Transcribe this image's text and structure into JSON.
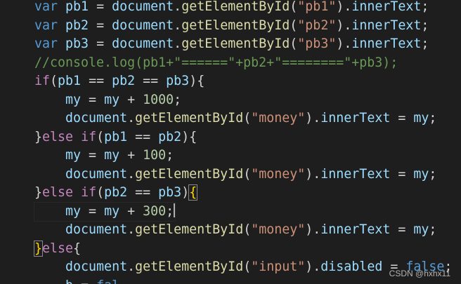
{
  "editor": {
    "lines": [
      [
        {
          "t": "var",
          "c": "kw"
        },
        {
          "t": " "
        },
        {
          "t": "pb1",
          "c": "var"
        },
        {
          "t": " = "
        },
        {
          "t": "document",
          "c": "var"
        },
        {
          "t": "."
        },
        {
          "t": "getElementById",
          "c": "fn"
        },
        {
          "t": "("
        },
        {
          "t": "\"pb1\"",
          "c": "str"
        },
        {
          "t": ")."
        },
        {
          "t": "innerText",
          "c": "var"
        },
        {
          "t": ";"
        }
      ],
      [
        {
          "t": "var",
          "c": "kw"
        },
        {
          "t": " "
        },
        {
          "t": "pb2",
          "c": "var"
        },
        {
          "t": " = "
        },
        {
          "t": "document",
          "c": "var"
        },
        {
          "t": "."
        },
        {
          "t": "getElementById",
          "c": "fn"
        },
        {
          "t": "("
        },
        {
          "t": "\"pb2\"",
          "c": "str"
        },
        {
          "t": ")."
        },
        {
          "t": "innerText",
          "c": "var"
        },
        {
          "t": ";"
        }
      ],
      [
        {
          "t": "var",
          "c": "kw"
        },
        {
          "t": " "
        },
        {
          "t": "pb3",
          "c": "var"
        },
        {
          "t": " = "
        },
        {
          "t": "document",
          "c": "var"
        },
        {
          "t": "."
        },
        {
          "t": "getElementById",
          "c": "fn"
        },
        {
          "t": "("
        },
        {
          "t": "\"pb3\"",
          "c": "str"
        },
        {
          "t": ")."
        },
        {
          "t": "innerText",
          "c": "var"
        },
        {
          "t": ";"
        }
      ],
      [
        {
          "t": "//console.log(pb1+\"======\"+pb2+\"========\"+pb3);",
          "c": "cmt"
        }
      ],
      [
        {
          "t": "if",
          "c": "ctrl"
        },
        {
          "t": "("
        },
        {
          "t": "pb1",
          "c": "var"
        },
        {
          "t": " == "
        },
        {
          "t": "pb2",
          "c": "var"
        },
        {
          "t": " == "
        },
        {
          "t": "pb3",
          "c": "var"
        },
        {
          "t": "){"
        }
      ],
      [
        {
          "t": "    "
        },
        {
          "t": "my",
          "c": "var"
        },
        {
          "t": " = "
        },
        {
          "t": "my",
          "c": "var"
        },
        {
          "t": " + "
        },
        {
          "t": "1000",
          "c": "num"
        },
        {
          "t": ";"
        }
      ],
      [
        {
          "t": "    "
        },
        {
          "t": "document",
          "c": "var"
        },
        {
          "t": "."
        },
        {
          "t": "getElementById",
          "c": "fn"
        },
        {
          "t": "("
        },
        {
          "t": "\"money\"",
          "c": "str"
        },
        {
          "t": ")."
        },
        {
          "t": "innerText",
          "c": "var"
        },
        {
          "t": " = "
        },
        {
          "t": "my",
          "c": "var"
        },
        {
          "t": ";"
        }
      ],
      [
        {
          "t": "}"
        },
        {
          "t": "else",
          "c": "ctrl"
        },
        {
          "t": " "
        },
        {
          "t": "if",
          "c": "ctrl"
        },
        {
          "t": "("
        },
        {
          "t": "pb1",
          "c": "var"
        },
        {
          "t": " == "
        },
        {
          "t": "pb2",
          "c": "var"
        },
        {
          "t": "){"
        }
      ],
      [
        {
          "t": "    "
        },
        {
          "t": "my",
          "c": "var"
        },
        {
          "t": " = "
        },
        {
          "t": "my",
          "c": "var"
        },
        {
          "t": " + "
        },
        {
          "t": "100",
          "c": "num"
        },
        {
          "t": ";"
        }
      ],
      [
        {
          "t": "    "
        },
        {
          "t": "document",
          "c": "var"
        },
        {
          "t": "."
        },
        {
          "t": "getElementById",
          "c": "fn"
        },
        {
          "t": "("
        },
        {
          "t": "\"money\"",
          "c": "str"
        },
        {
          "t": ")."
        },
        {
          "t": "innerText",
          "c": "var"
        },
        {
          "t": " = "
        },
        {
          "t": "my",
          "c": "var"
        },
        {
          "t": ";"
        }
      ],
      [
        {
          "t": "}"
        },
        {
          "t": "else",
          "c": "ctrl"
        },
        {
          "t": " "
        },
        {
          "t": "if",
          "c": "ctrl"
        },
        {
          "t": "("
        },
        {
          "t": "pb2",
          "c": "var"
        },
        {
          "t": " == "
        },
        {
          "t": "pb3",
          "c": "var"
        },
        {
          "t": ")"
        },
        {
          "t": "{",
          "c": "brace match"
        }
      ],
      [
        {
          "t": "    "
        },
        {
          "t": "my",
          "c": "var"
        },
        {
          "t": " = "
        },
        {
          "t": "my",
          "c": "var"
        },
        {
          "t": " + "
        },
        {
          "t": "300",
          "c": "num"
        },
        {
          "t": ";"
        },
        {
          "t": "",
          "c": "cursor"
        }
      ],
      [
        {
          "t": "    "
        },
        {
          "t": "document",
          "c": "var"
        },
        {
          "t": "."
        },
        {
          "t": "getElementById",
          "c": "fn"
        },
        {
          "t": "("
        },
        {
          "t": "\"money\"",
          "c": "str"
        },
        {
          "t": ")."
        },
        {
          "t": "innerText",
          "c": "var"
        },
        {
          "t": " = "
        },
        {
          "t": "my",
          "c": "var"
        },
        {
          "t": ";"
        }
      ],
      [
        {
          "t": "}",
          "c": "brace match"
        },
        {
          "t": "else",
          "c": "ctrl"
        },
        {
          "t": "{"
        }
      ],
      [
        {
          "t": "    "
        },
        {
          "t": "document",
          "c": "var"
        },
        {
          "t": "."
        },
        {
          "t": "getElementById",
          "c": "fn"
        },
        {
          "t": "("
        },
        {
          "t": "\"input\"",
          "c": "str"
        },
        {
          "t": ")."
        },
        {
          "t": "disabled",
          "c": "var"
        },
        {
          "t": " = "
        },
        {
          "t": "false",
          "c": "kw"
        },
        {
          "t": ";"
        }
      ],
      [
        {
          "t": "    "
        },
        {
          "t": "b",
          "c": "var"
        },
        {
          "t": " = "
        },
        {
          "t": "fal",
          "c": "kw"
        }
      ]
    ],
    "current_line": 11
  },
  "watermark": {
    "text": "CSDN @hxhx11"
  },
  "colors": {
    "background": "#1e1e1e",
    "keyword": "#569cd6",
    "control": "#c586c0",
    "variable": "#9cdcfe",
    "function": "#dcdcaa",
    "string": "#ce9178",
    "number": "#b5cea8",
    "comment": "#6a9955"
  }
}
